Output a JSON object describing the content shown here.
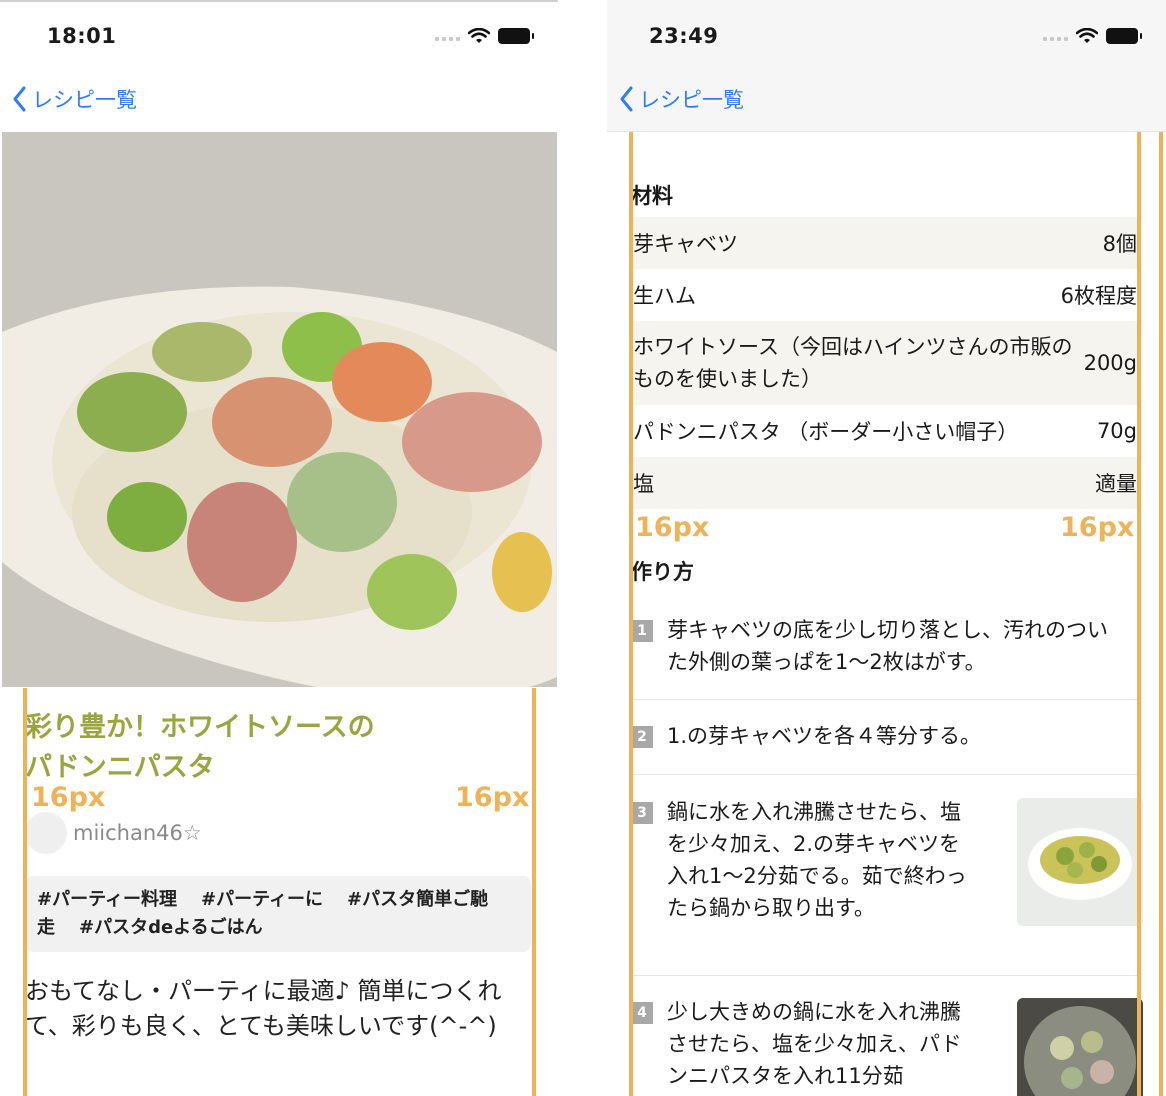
{
  "left": {
    "status_time": "18:01",
    "back_label": "レシピ一覧",
    "title_lines": [
      "彩り豊か！ホワイトソースの",
      "パドンニパスタ"
    ],
    "author": "miichan46☆",
    "tags": [
      "#パーティー料理",
      "#パーティーに",
      "#パスタ簡単ご馳走",
      "#パスタdeよるごはん"
    ],
    "description": "おもてなし・パーティに最適♪ 簡単につくれて、彩りも良く、とても美味しいです(^-^)",
    "margin_left_label": "16px",
    "margin_right_label": "16px"
  },
  "right": {
    "status_time": "23:49",
    "back_label": "レシピ一覧",
    "ingredients_heading": "材料",
    "ingredients": [
      {
        "name": "芽キャベツ",
        "amount": "8個"
      },
      {
        "name": "生ハム",
        "amount": "6枚程度"
      },
      {
        "name": "ホワイトソース（今回はハインツさんの市販のものを使いました）",
        "amount": "200g"
      },
      {
        "name": "パドンニパスタ （ボーダー小さい帽子）",
        "amount": "70g"
      },
      {
        "name": "塩",
        "amount": "適量"
      }
    ],
    "margin_left_label": "16px",
    "margin_right_label": "16px",
    "steps_heading": "作り方",
    "steps": [
      {
        "num": "1",
        "text": "芽キャベツの底を少し切り落とし、汚れのついた外側の葉っぱを1〜2枚はがす。"
      },
      {
        "num": "2",
        "text": "1.の芽キャベツを各４等分する。"
      },
      {
        "num": "3",
        "text": "鍋に水を入れ沸騰させたら、塩を少々加え、2.の芽キャベツを入れ1〜2分茹でる。茹で終わったら鍋から取り出す。"
      },
      {
        "num": "4",
        "text": "少し大きめの鍋に水を入れ沸騰させたら、塩を少々加え、パドンニパスタを入れ11分茹"
      }
    ]
  },
  "colors": {
    "accent_blue": "#2f7cf6",
    "title_green": "#9aa63a",
    "guide_orange": "#efb256"
  }
}
